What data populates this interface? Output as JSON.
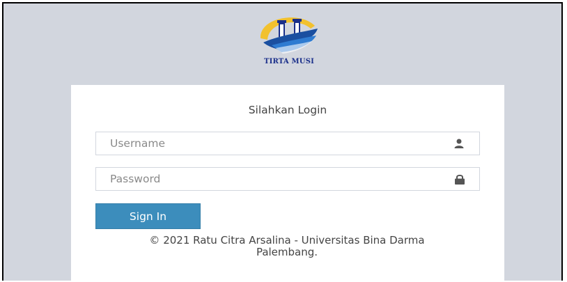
{
  "logo": {
    "text": "TIRTA MUSI",
    "icon": "tirta-musi-logo"
  },
  "login": {
    "title": "Silahkan Login",
    "username": {
      "placeholder": "Username",
      "value": "",
      "icon": "user-icon"
    },
    "password": {
      "placeholder": "Password",
      "value": "",
      "icon": "lock-icon"
    },
    "sign_in_label": "Sign In",
    "footer_line1": "© 2021 Ratu Citra Arsalina - Universitas Bina Darma",
    "footer_line2": "Palembang."
  },
  "colors": {
    "page_bg": "#d2d6de",
    "box_bg": "#ffffff",
    "button_bg": "#3c8dbc",
    "logo_gold": "#f2c12e",
    "logo_blue": "#1a4fa0"
  }
}
